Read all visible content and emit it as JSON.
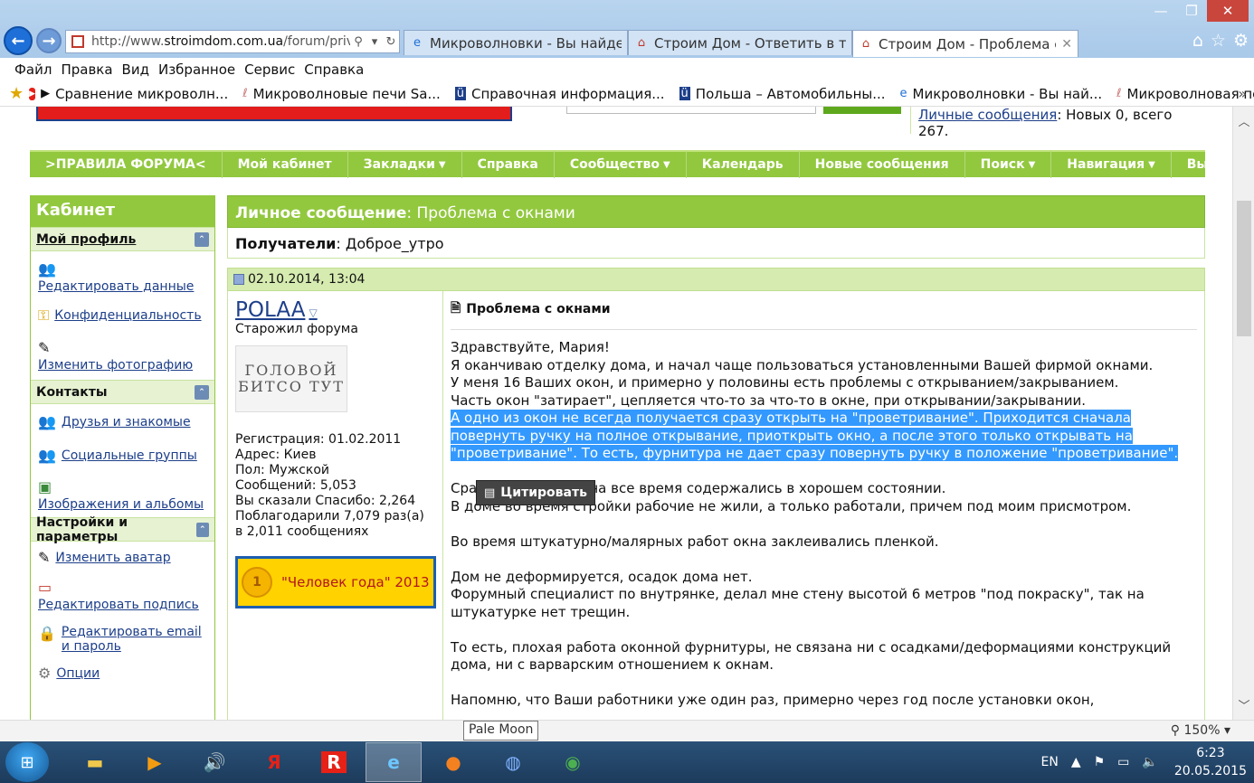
{
  "browser": {
    "url_prefix": "http://www.",
    "url_domain": "stroimdom.com.ua",
    "url_rest": "/forum/priv",
    "tabs": [
      {
        "label": "Микроволновки - Вы найдете ..."
      },
      {
        "label": "Строим Дом - Ответить в теме"
      },
      {
        "label": "Строим Дом - Проблема с ..."
      }
    ],
    "menu": [
      "Файл",
      "Правка",
      "Вид",
      "Избранное",
      "Сервис",
      "Справка"
    ],
    "favorites": [
      "Сравнение микроволн...",
      "Микроволновые печи Sa...",
      "Справочная информация...",
      "Польша – Автомобильны...",
      "Микроволновки - Вы най...",
      "Микроволновая печь LG ..."
    ]
  },
  "header": {
    "pm_link": "Личные сообщения",
    "pm_counts": ": Новых 0, всего 267."
  },
  "navbar": [
    ">ПРАВИЛА ФОРУМА<",
    "Мой кабинет",
    "Закладки",
    "Справка",
    "Сообщество",
    "Календарь",
    "Новые сообщения",
    "Поиск",
    "Навигация",
    "Выход"
  ],
  "sidebar": {
    "title": "Кабинет",
    "section_profile": "Мой профиль",
    "edit_data": "Редактировать данные",
    "privacy": "Конфиденциальность",
    "change_photo": "Изменить фотографию",
    "section_contacts": "Контакты",
    "friends": "Друзья и знакомые",
    "groups": "Социальные группы",
    "images": "Изображения и альбомы",
    "section_settings": "Настройки и параметры",
    "change_avatar": "Изменить аватар",
    "edit_signature": "Редактировать подпись",
    "edit_email": "Редактировать email и пароль",
    "options": "Опции"
  },
  "message": {
    "header_label": "Личное сообщение",
    "header_title": ": Проблема с окнами",
    "recipients_label": "Получатели",
    "recipients_value": ": Доброе_утро",
    "date": "02.10.2014, 13:04",
    "author": "POLAA",
    "rank": "Старожил форума",
    "avatar_text": "ГОЛОВОЙ БИТСО ТУТ",
    "reg": "Регистрация: 01.02.2011",
    "address": "Адрес: Киев",
    "gender": "Пол: Мужской",
    "posts": "Сообщений: 5,053",
    "thanked": "Вы сказали Спасибо: 2,264",
    "thanks_received": "Поблагодарили 7,079 раз(а) в 2,011 сообщениях",
    "award_number": "1",
    "award": "\"Человек года\" 2013",
    "title": "Проблема с окнами",
    "quote_button": "Цитировать",
    "lines": {
      "greet": "Здравствуйте, Мария!",
      "l1": "Я оканчиваю отделку дома, и начал чаще пользоваться установленными Вашей фирмой окнами.",
      "l2": "У меня 16 Ваших окон, и примерно у половины есть проблемы с открыванием/закрыванием.",
      "l3": "Часть окон \"затирает\", цепляется что-то за что-то в окне, при открывании/закрывании.",
      "sel": "А одно из окон не всегда получается сразу открыть на \"проветривание\". Приходится сначала повернуть ручку на полное открывание, приоткрыть окно, а после этого только открывать на \"проветривание\". То есть, фурнитура не дает сразу повернуть ручку в положение \"проветривание\".",
      "l4a": "Сра",
      "l4b": "о окна все время содержались в хорошем состоянии.",
      "l5": "В доме во время стройки рабочие не жили, а только работали, причем под моим присмотром.",
      "l6": "Во время штукатурно/малярных работ окна заклеивались пленкой.",
      "l7": "Дом не деформируется, осадок дома нет.",
      "l8": "Форумный специалист по внутрянке, делал мне стену высотой 6 метров \"под покраску\", так на штукатурке нет трещин.",
      "l9": "То есть, плохая работа оконной фурнитуры, не связана ни с осадками/деформациями конструкций дома, ни с варварским отношением к окнам.",
      "l10": "Напомню, что Ваши работники уже один раз, примерно через год после установки окон,"
    }
  },
  "status": {
    "tooltip": "Pale Moon",
    "zoom": "150%"
  },
  "taskbar": {
    "lang": "EN",
    "time": "6:23",
    "date": "20.05.2015"
  }
}
